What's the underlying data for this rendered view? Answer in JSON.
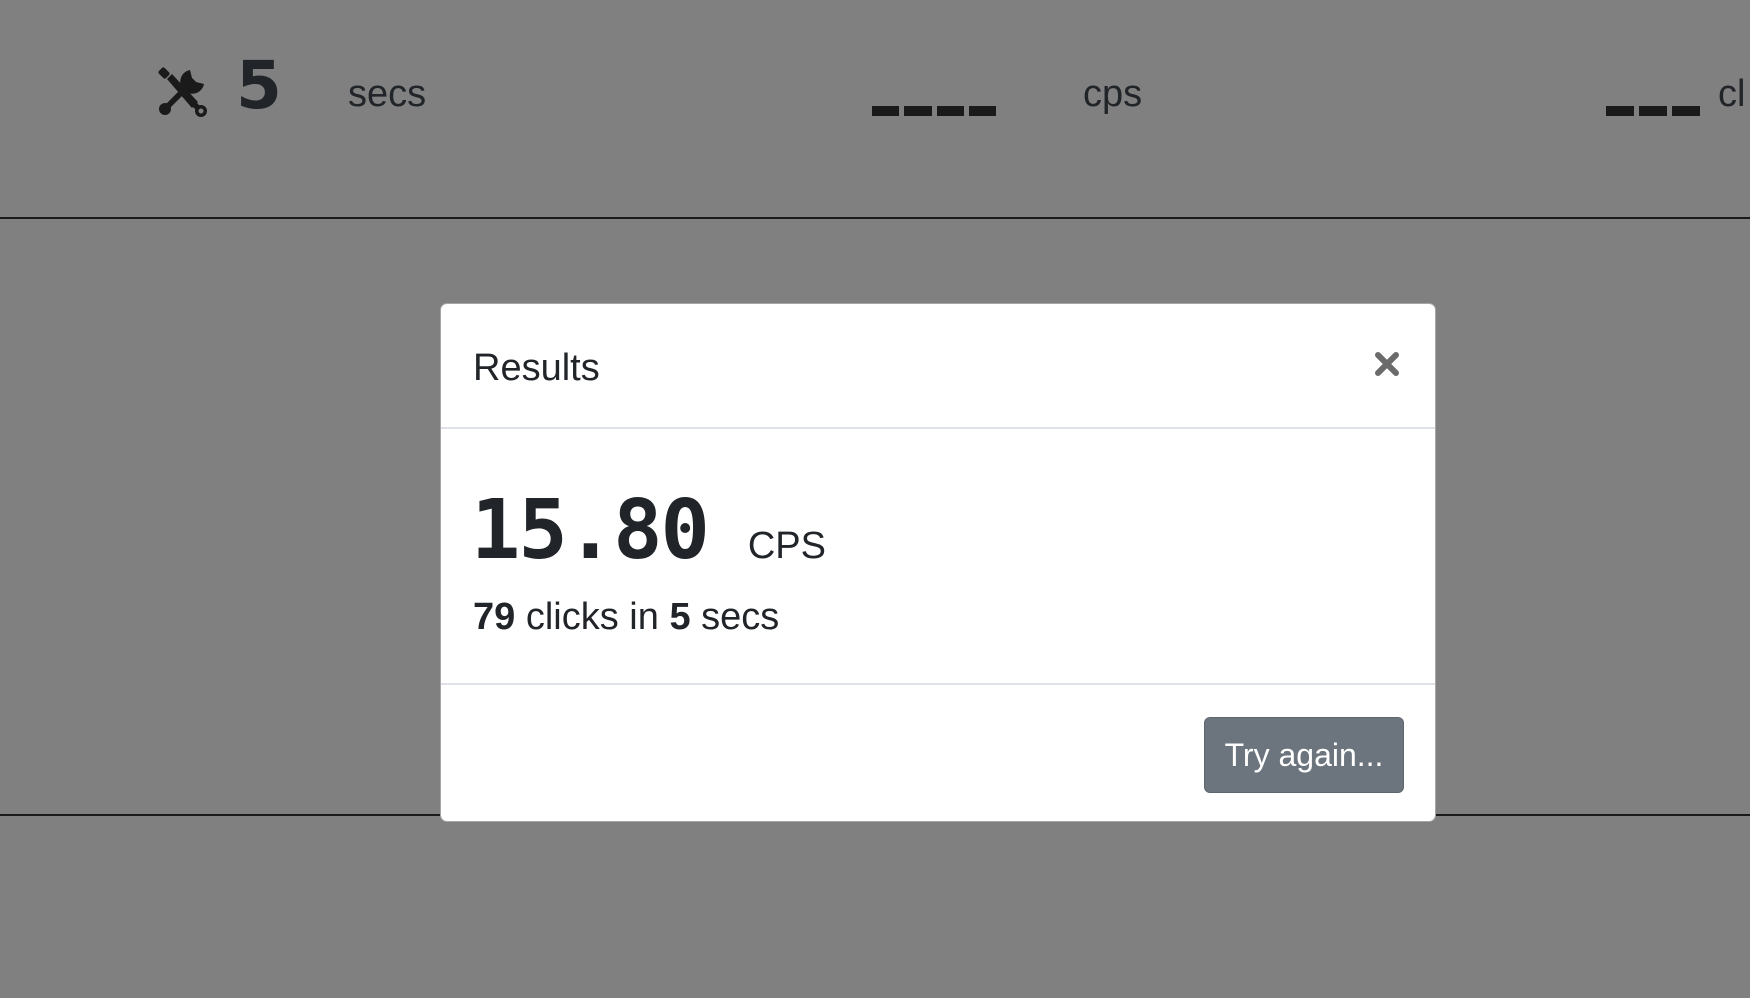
{
  "stats_bar": {
    "tools_icon": "tools-icon",
    "duration_value": "5",
    "duration_unit": "secs",
    "cps_placeholder": "____",
    "cps_unit": "cps",
    "clicks_placeholder": "___",
    "clicks_unit": "cl"
  },
  "modal": {
    "title": "Results",
    "close_icon": "close-icon",
    "result_value": "15.80",
    "result_unit": "CPS",
    "clicks_count": "79",
    "clicks_text": "clicks in",
    "seconds_count": "5",
    "seconds_text": "secs",
    "try_again_label": "Try again..."
  },
  "colors": {
    "backdrop": "#808080",
    "modal_background": "#ffffff",
    "button_background": "#6c757d",
    "text": "#212529"
  }
}
